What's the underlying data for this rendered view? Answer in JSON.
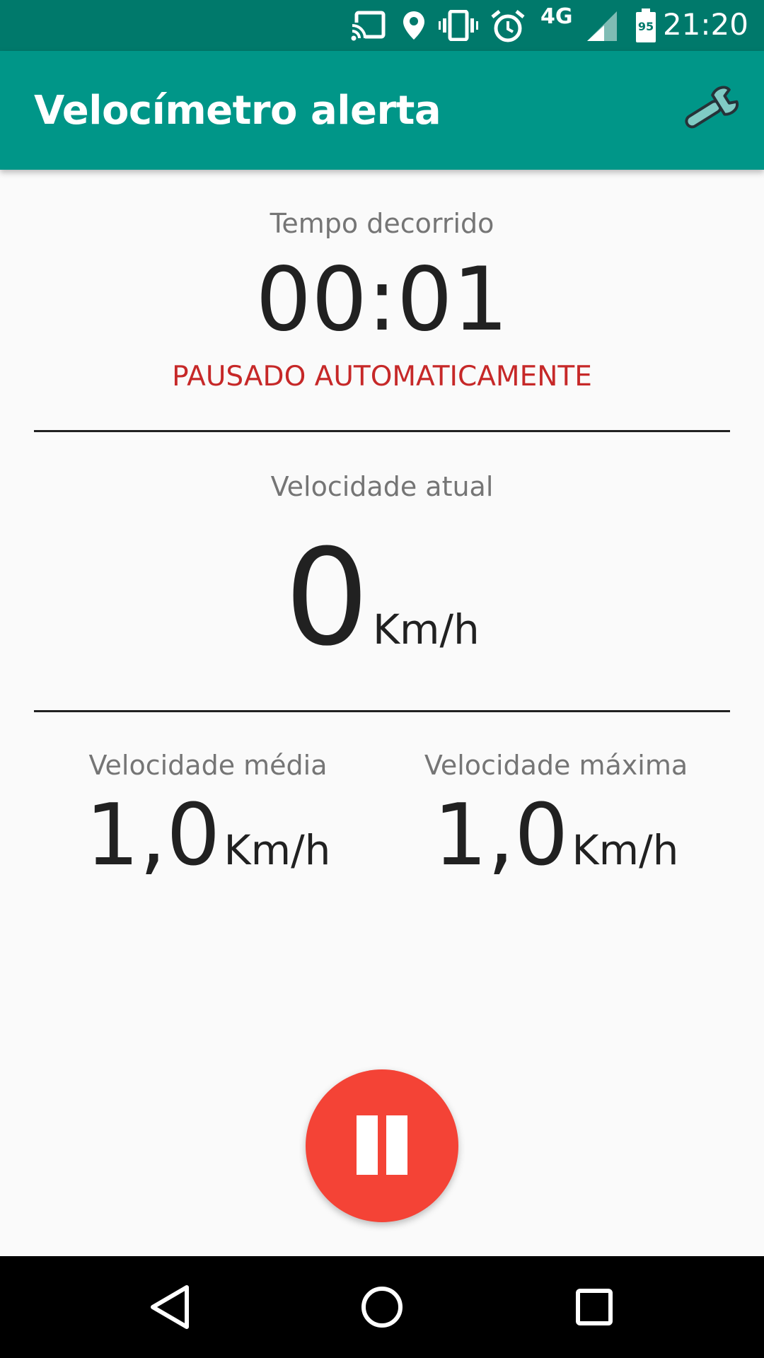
{
  "status_bar": {
    "time": "21:20",
    "network": "4G",
    "battery_level": "95",
    "icons": [
      "cast-icon",
      "location-icon",
      "vibrate-icon",
      "alarm-icon",
      "signal-icon",
      "battery-icon"
    ]
  },
  "app_bar": {
    "title": "Velocímetro alerta",
    "settings_icon": "wrench-icon"
  },
  "elapsed": {
    "label": "Tempo decorrido",
    "value": "00:01",
    "status": "PAUSADO AUTOMATICAMENTE"
  },
  "current_speed": {
    "label": "Velocidade atual",
    "value": "0",
    "unit": "Km/h"
  },
  "average_speed": {
    "label": "Velocidade média",
    "value": "1,0",
    "unit": "Km/h"
  },
  "max_speed": {
    "label": "Velocidade máxima",
    "value": "1,0",
    "unit": "Km/h"
  },
  "fab": {
    "icon": "pause-icon"
  },
  "nav_bar": {
    "icons": [
      "back-icon",
      "home-icon",
      "recents-icon"
    ]
  },
  "colors": {
    "status_bar": "#00796b",
    "app_bar": "#009688",
    "paused_text": "#c62828",
    "fab": "#f44336"
  }
}
